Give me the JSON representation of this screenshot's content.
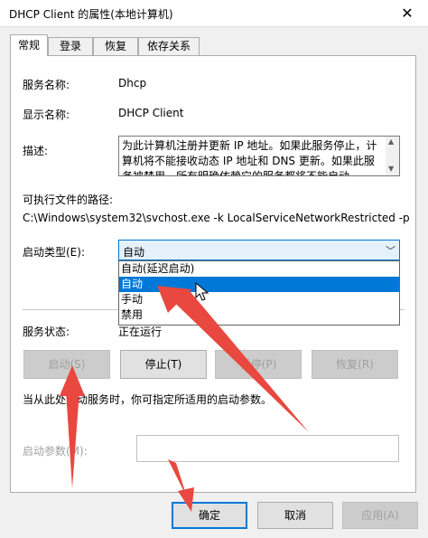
{
  "window": {
    "title": "DHCP Client 的属性(本地计算机)",
    "close_glyph": "✕"
  },
  "tabs": [
    "常规",
    "登录",
    "恢复",
    "依存关系"
  ],
  "general": {
    "service_name_label": "服务名称:",
    "service_name": "Dhcp",
    "display_name_label": "显示名称:",
    "display_name": "DHCP Client",
    "description_label": "描述:",
    "description": "为此计算机注册并更新 IP 地址。如果此服务停止，计算机将不能接收动态 IP 地址和 DNS 更新。如果此服务被禁用，所有明确依赖它的服务都将不能启动。",
    "path_label": "可执行文件的路径:",
    "path": "C:\\Windows\\system32\\svchost.exe -k LocalServiceNetworkRestricted -p",
    "startup_type_label": "启动类型(E):",
    "startup_type_value": "自动",
    "startup_options": [
      "自动(延迟启动)",
      "自动",
      "手动",
      "禁用"
    ],
    "status_label": "服务状态:",
    "status_value": "正在运行",
    "buttons": {
      "start": "启动(S)",
      "stop": "停止(T)",
      "pause": "暂停(P)",
      "resume": "恢复(R)"
    },
    "hint": "当从此处启动服务时，你可指定所适用的启动参数。",
    "params_label": "启动参数(M):",
    "params_value": ""
  },
  "footer": {
    "ok": "确定",
    "cancel": "取消",
    "apply": "应用(A)"
  },
  "colors": {
    "accent": "#0078d7",
    "arrow": "#e8483f"
  }
}
